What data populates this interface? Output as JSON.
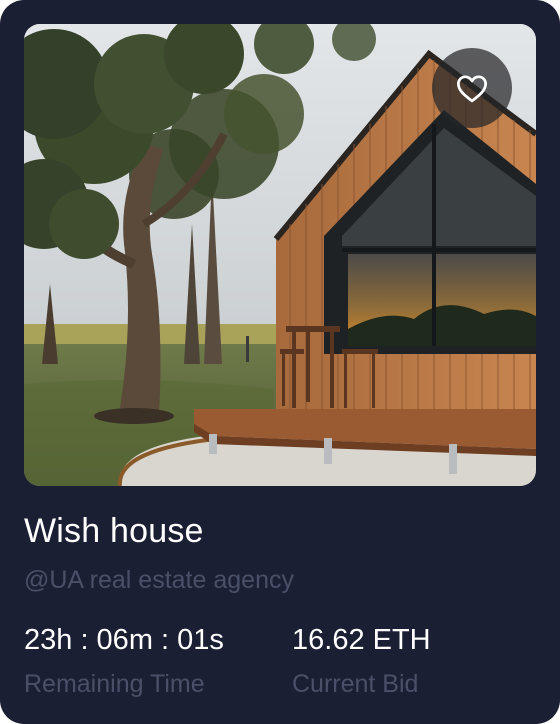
{
  "card": {
    "title": "Wish house",
    "creator": "@UA real estate agency",
    "favorite_icon": "heart-outline-icon",
    "remaining": {
      "value": "23h : 06m : 01s",
      "label": "Remaining Time"
    },
    "bid": {
      "value": "16.62 ETH",
      "label": "Current Bid"
    }
  },
  "colors": {
    "card_background": "#1b1f33",
    "muted_text": "#4a5068",
    "primary_text": "#ffffff"
  }
}
